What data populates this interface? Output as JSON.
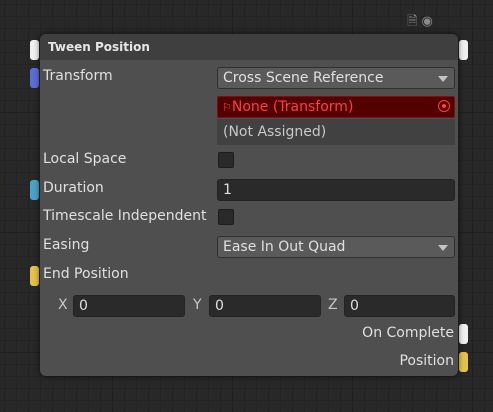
{
  "node": {
    "title": "Tween Position",
    "transform": {
      "label": "Transform",
      "dropdown_value": "Cross Scene Reference",
      "missing_value": "None (Transform)",
      "not_assigned": "(Not Assigned)"
    },
    "local_space": {
      "label": "Local Space",
      "checked": false
    },
    "duration": {
      "label": "Duration",
      "value": "1"
    },
    "timescale_independent": {
      "label": "Timescale Independent",
      "checked": false
    },
    "easing": {
      "label": "Easing",
      "value": "Ease In Out Quad"
    },
    "end_position": {
      "label": "End Position",
      "x_label": "X",
      "x_value": "0",
      "y_label": "Y",
      "y_value": "0",
      "z_label": "Z",
      "z_value": "0"
    },
    "outputs": {
      "on_complete": "On Complete",
      "position": "Position"
    }
  },
  "port_colors": {
    "flow": "#f0f0f0",
    "transform": "#5b6dd8",
    "float": "#4aa3c8",
    "vector3": "#e6c24a"
  }
}
